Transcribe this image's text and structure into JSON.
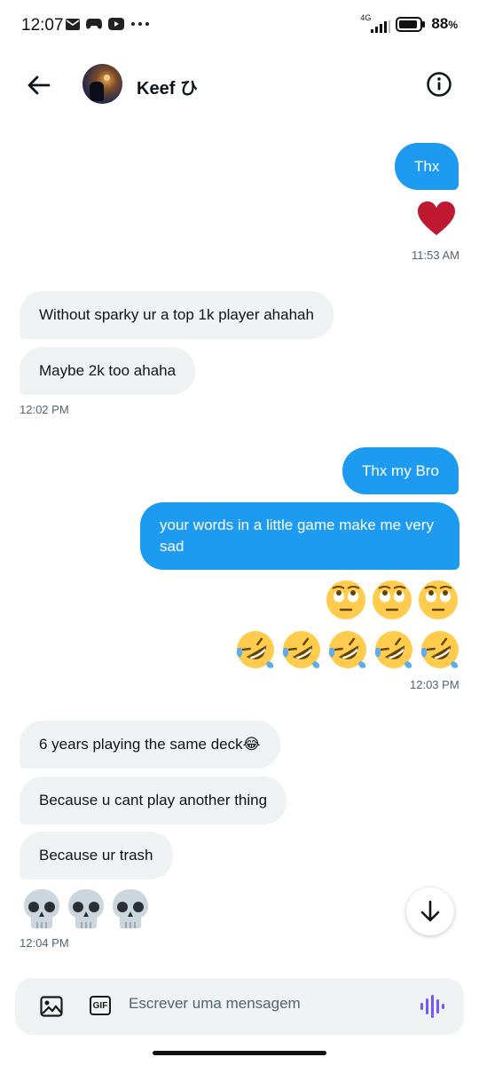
{
  "status_bar": {
    "time": "12:07",
    "network": "4G",
    "battery": "88",
    "battery_unit": "%"
  },
  "header": {
    "contact_name": "Keef ひ"
  },
  "messages": {
    "m1": "Thx",
    "m1_time": "11:53 AM",
    "m2": "Without sparky ur a top 1k player ahahah",
    "m3": "Maybe 2k too ahaha",
    "m3_time": "12:02 PM",
    "m4": "Thx my Bro",
    "m5_line1": "your words in a little game make me very",
    "m5_line2": "sad",
    "m6_time": "12:03 PM",
    "m7": "6 years playing the same deck😂",
    "m8": "Because u cant play another thing",
    "m9": "Because ur trash",
    "m10_time": "12:04 PM"
  },
  "composer": {
    "placeholder": "Escrever uma mensagem",
    "gif_label": "GIF"
  },
  "colors": {
    "accent": "#1d9bf0",
    "received_bubble": "#eff3f4",
    "heart": "#be1931",
    "voice": "#7856ff"
  }
}
